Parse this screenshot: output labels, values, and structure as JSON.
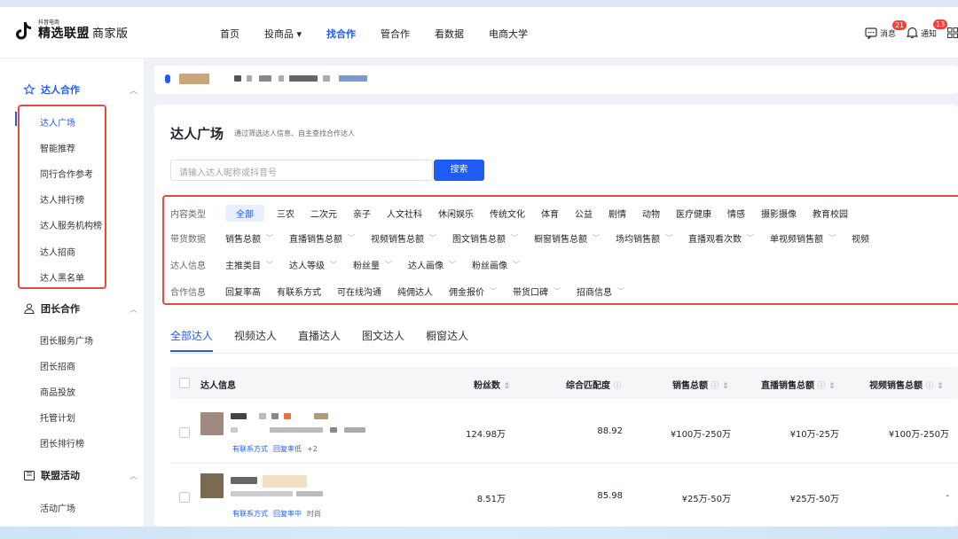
{
  "header": {
    "logo_small": "抖音电商",
    "logo_main": "精选联盟",
    "logo_sub": "商家版",
    "nav": [
      {
        "label": "首页",
        "active": false
      },
      {
        "label": "投商品 ▾",
        "active": false
      },
      {
        "label": "找合作",
        "active": true
      },
      {
        "label": "管合作",
        "active": false
      },
      {
        "label": "看数据",
        "active": false
      },
      {
        "label": "电商大学",
        "active": false
      }
    ],
    "messages_label": "消息",
    "messages_count": "21",
    "notify_label": "通知",
    "notify_count": "13"
  },
  "sidebar": {
    "sections": [
      {
        "label": "达人合作",
        "items": [
          "达人广场",
          "智能推荐",
          "同行合作参考",
          "达人排行榜",
          "达人服务机构榜",
          "达人招商",
          "达人黑名单"
        ]
      },
      {
        "label": "团长合作",
        "items": [
          "团长服务广场",
          "团长招商",
          "商品投放",
          "托管计划",
          "团长排行榜"
        ]
      },
      {
        "label": "联盟活动",
        "items": [
          "活动广场"
        ]
      }
    ]
  },
  "page": {
    "title": "达人广场",
    "desc": "通过筛选达人信息、自主查找合作达人",
    "search_placeholder": "请输入达人昵称或抖音号",
    "search_btn": "搜索"
  },
  "filters": {
    "content_label": "内容类型",
    "content_chips": [
      "全部",
      "三农",
      "二次元",
      "亲子",
      "人文社科",
      "休闲娱乐",
      "传统文化",
      "体育",
      "公益",
      "剧情",
      "动物",
      "医疗健康",
      "情感",
      "摄影摄像",
      "教育校园"
    ],
    "sales_label": "带货数据",
    "sales_chips": [
      "销售总额",
      "直播销售总额",
      "视频销售总额",
      "图文销售总额",
      "橱窗销售总额",
      "场均销售额",
      "直播观看次数",
      "单视频销售额",
      "视频"
    ],
    "info_label": "达人信息",
    "info_chips": [
      "主推类目",
      "达人等级",
      "粉丝量",
      "达人画像",
      "粉丝画像"
    ],
    "coop_label": "合作信息",
    "coop_chips": [
      "回复率高",
      "有联系方式",
      "可在线沟通",
      "纯佣达人",
      "佣金报价",
      "带货口碑",
      "招商信息"
    ]
  },
  "tabs": [
    "全部达人",
    "视频达人",
    "直播达人",
    "图文达人",
    "橱窗达人"
  ],
  "table": {
    "headers": [
      "达人信息",
      "粉丝数",
      "综合匹配度",
      "销售总额",
      "直播销售总额",
      "视频销售总额"
    ],
    "rows": [
      {
        "fans": "124.98万",
        "match": "88.92",
        "sales": "¥100万-250万",
        "live": "¥10万-25万",
        "video": "¥100万-250万",
        "tag1": "有联系方式",
        "tag2": "回复率低",
        "tag3": "+2"
      },
      {
        "fans": "8.51万",
        "match": "85.98",
        "sales": "¥25万-50万",
        "live": "¥25万-50万",
        "video": "-",
        "tag1": "有联系方式",
        "tag2": "回复率中",
        "tag3": "时尚"
      }
    ]
  }
}
